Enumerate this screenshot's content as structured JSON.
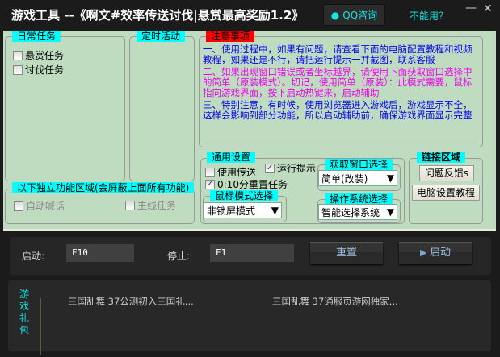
{
  "window": {
    "title": "游戏工具 --《啊文#效率传送讨伐|悬赏最高奖励1.2》",
    "qq_button": "QQ咨询",
    "cant_use": "不能用？",
    "minimize": "—",
    "close": "✕"
  },
  "daily": {
    "label": "日常任务",
    "items": [
      "悬赏任务",
      "讨伐任务"
    ]
  },
  "timed": {
    "label": "定时活动"
  },
  "independent": {
    "label": "以下独立功能区域(会屏蔽上面所有功能)",
    "items": [
      "自动喊话",
      "主线任务"
    ]
  },
  "notice": {
    "label": "注意事项",
    "p1": "一、使用过程中，如果有问题，请查看下面的电脑配置教程和视频教程，如果还是不行，请把运行提示一并截图，联系客服",
    "p2": "二、如果出现窗口错误或者坐标越界，请使用下面获取窗口选择中的简单（原装模式）。切记，使用简单（原装）：此模式需要，鼠标指向游戏界面，按下启动热键来，启动辅助",
    "p3": "三、特别注意，有时候，使用浏览器进入游戏后，游戏显示不全，这样会影响到部分功能，所以启动辅助前，确保游戏界面显示完整",
    "colors": {
      "p1": "#0000ee",
      "p2": "#ee00ee",
      "p3": "#0000ee"
    }
  },
  "general": {
    "label": "通用设置",
    "use_teleport": "使用传送",
    "run_hint": "运行提示",
    "reset_task": "0:10分重置任务",
    "use_teleport_checked": false,
    "run_hint_checked": true,
    "reset_task_checked": true
  },
  "mouse_mode": {
    "label": "鼠标模式选择",
    "value": "非锁屏模式"
  },
  "window_select": {
    "label": "获取窗口选择",
    "value": "简单(改装)"
  },
  "os_select": {
    "label": "操作系统选择",
    "value": "智能选择系统"
  },
  "links": {
    "label": "链接区域",
    "feedback": "问题反馈s",
    "tutorial": "电脑设置教程"
  },
  "hotkeys": {
    "start_label": "启动:",
    "start_value": "F10",
    "stop_label": "停止:",
    "stop_value": "F1",
    "reset_button": "重置",
    "start_button": "启动"
  },
  "gifts": {
    "label": "游戏礼包",
    "items": [
      "三国乱舞 37公测初入三国礼...",
      "三国乱舞 37通服页游网独家..."
    ]
  }
}
